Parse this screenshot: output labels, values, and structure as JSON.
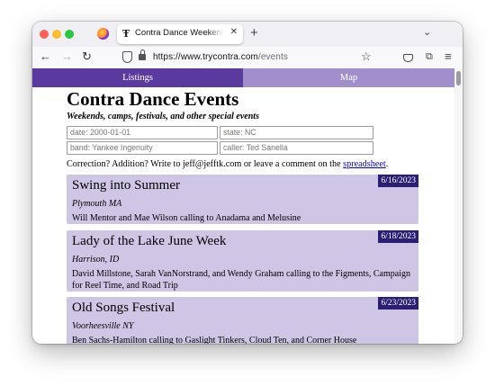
{
  "browser": {
    "tab_title": "Contra Dance Weekends, Festiv",
    "tab_favicon": "Ŧ",
    "url_domain": "https://www.trycontra.com",
    "url_path": "/events"
  },
  "icons": {
    "back": "arrow-left-icon",
    "forward": "arrow-right-icon",
    "reload": "reload-icon",
    "shield": "tracking-protection-shield-icon",
    "lock": "lock-icon",
    "bookmark": "star-icon",
    "pocket": "pocket-icon",
    "extensions": "extensions-icon",
    "menu": "hamburger-menu-icon",
    "firefox": "firefox-view-icon"
  },
  "colors": {
    "tab_active": "#5b3aa0",
    "tab_inactive": "#a08fcc",
    "event_bg": "#cfc5e4",
    "date_badge": "#2b1f75",
    "link": "#0000ee"
  },
  "site": {
    "tabs": [
      {
        "label": "Listings"
      },
      {
        "label": "Map"
      }
    ],
    "title": "Contra Dance Events",
    "subtitle": "Weekends, camps, festivals, and other special events",
    "filters": {
      "date_placeholder": "date: 2000-01-01",
      "state_placeholder": "state: NC",
      "band_placeholder": "band: Yankee Ingenuity",
      "caller_placeholder": "caller: Ted Sanella"
    },
    "correction_text": "Correction? Addition? Write to jeff@jefftk.com or leave a comment on the ",
    "correction_link": "spreadsheet",
    "correction_end": ".",
    "events": [
      {
        "title": "Swing into Summer",
        "date": "6/16/2023",
        "location": "Plymouth MA",
        "description": "Will Mentor and Mae Wilson calling to Anadama and Melusine"
      },
      {
        "title": "Lady of the Lake June Week",
        "date": "6/18/2023",
        "location": "Harrison, ID",
        "description": "David Millstone, Sarah VanNorstrand, and Wendy Graham calling to the Figments, Campaign for Reel Time, and Road Trip"
      },
      {
        "title": "Old Songs Festival",
        "date": "6/23/2023",
        "location": "Voorheesville NY",
        "description": "Ben Sachs-Hamilton calling to Gaslight Tinkers, Cloud Ten, and Corner House"
      }
    ]
  }
}
